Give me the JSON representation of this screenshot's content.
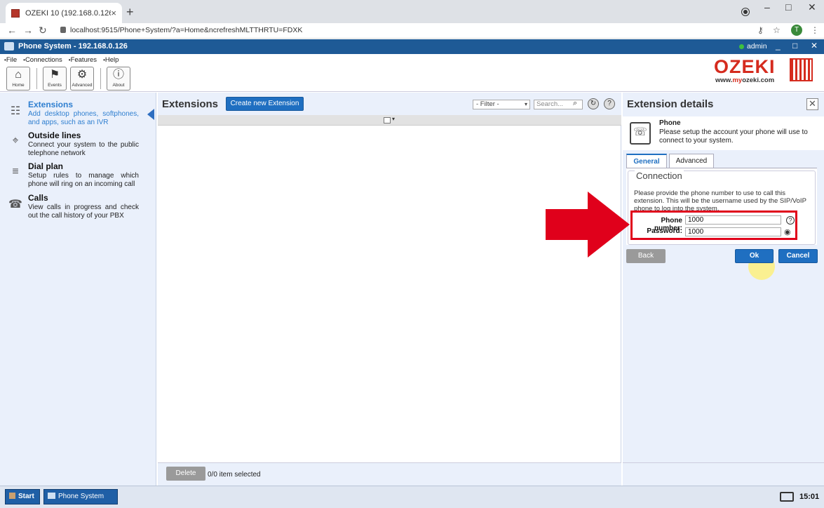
{
  "browser": {
    "tab_title": "OZEKI 10 (192.168.0.126)",
    "tab_close": "×",
    "new_tab": "+",
    "url": "localhost:9515/Phone+System/?a=Home&ncrefreshMLTTHRTU=FDXK",
    "avatar_letter": "T",
    "nav": {
      "back": "←",
      "forward": "→",
      "reload": "↻"
    },
    "window_controls": {
      "minimize": "–",
      "maximize": "□",
      "close": "✕"
    },
    "address_icons": {
      "key": "⚷",
      "star": "☆",
      "menu": "⋮"
    }
  },
  "app": {
    "title": "Phone System - 192.168.0.126",
    "user": "admin",
    "window_controls": {
      "minimize": "_",
      "maximize": "□",
      "close": "✕"
    }
  },
  "menu": [
    "File",
    "Connections",
    "Features",
    "Help"
  ],
  "toolbar": {
    "home": {
      "label": "Home",
      "icon": "⌂"
    },
    "events": {
      "label": "Events",
      "icon": "⚑"
    },
    "advanced": {
      "label": "Advanced",
      "icon": "⚙"
    },
    "about": {
      "label": "About",
      "icon": "ⓘ"
    }
  },
  "logo": {
    "word": "OZEKI",
    "url_prefix": "www.",
    "url_my": "my",
    "url_rest": "ozeki.com",
    "color": "#d52b1e"
  },
  "sidebar": {
    "items": [
      {
        "title": "Extensions",
        "desc": "Add desktop phones, softphones, and apps, such as an IVR",
        "icon": "☷"
      },
      {
        "title": "Outside lines",
        "desc": "Connect your system to the public telephone network",
        "icon": "⌖"
      },
      {
        "title": "Dial plan",
        "desc": "Setup rules to manage which phone will ring on an incoming call",
        "icon": "≡"
      },
      {
        "title": "Calls",
        "desc": "View calls in progress and check out the call history of your PBX",
        "icon": "☎"
      }
    ]
  },
  "extensions": {
    "title": "Extensions",
    "create_button": "Create new Extension",
    "filter": "- Filter -",
    "filter_caret": "▾",
    "search_placeholder": "Search...",
    "icons": {
      "search": "⌕",
      "refresh": "↻",
      "help": "?"
    },
    "column_caret": "▾",
    "delete_button": "Delete",
    "selection_text": "0/0 item selected"
  },
  "details": {
    "title": "Extension details",
    "close_glyph": "✕",
    "phone_icon": "☏",
    "phone_name": "Phone",
    "phone_desc": "Please setup the account your phone will use to connect to your system.",
    "tabs": [
      "General",
      "Advanced"
    ],
    "legend": "Connection",
    "connection_desc": "Please provide the phone number to use to call this extension. This will be the username used by the SIP/VoIP phone to log into the system.",
    "phone_number_label": "Phone number:",
    "phone_number_value": "1000",
    "password_label": "Password:",
    "password_value": "1000",
    "icons": {
      "help": "?",
      "eye": "◉"
    },
    "back_button": "Back",
    "ok_button": "Ok",
    "cancel_button": "Cancel"
  },
  "taskbar": {
    "start": "Start",
    "task": "Phone System",
    "clock": "15:01"
  },
  "colors": {
    "accent": "#1f6fc1",
    "titlebar": "#1e5a96",
    "highlight": "#e0001b"
  }
}
